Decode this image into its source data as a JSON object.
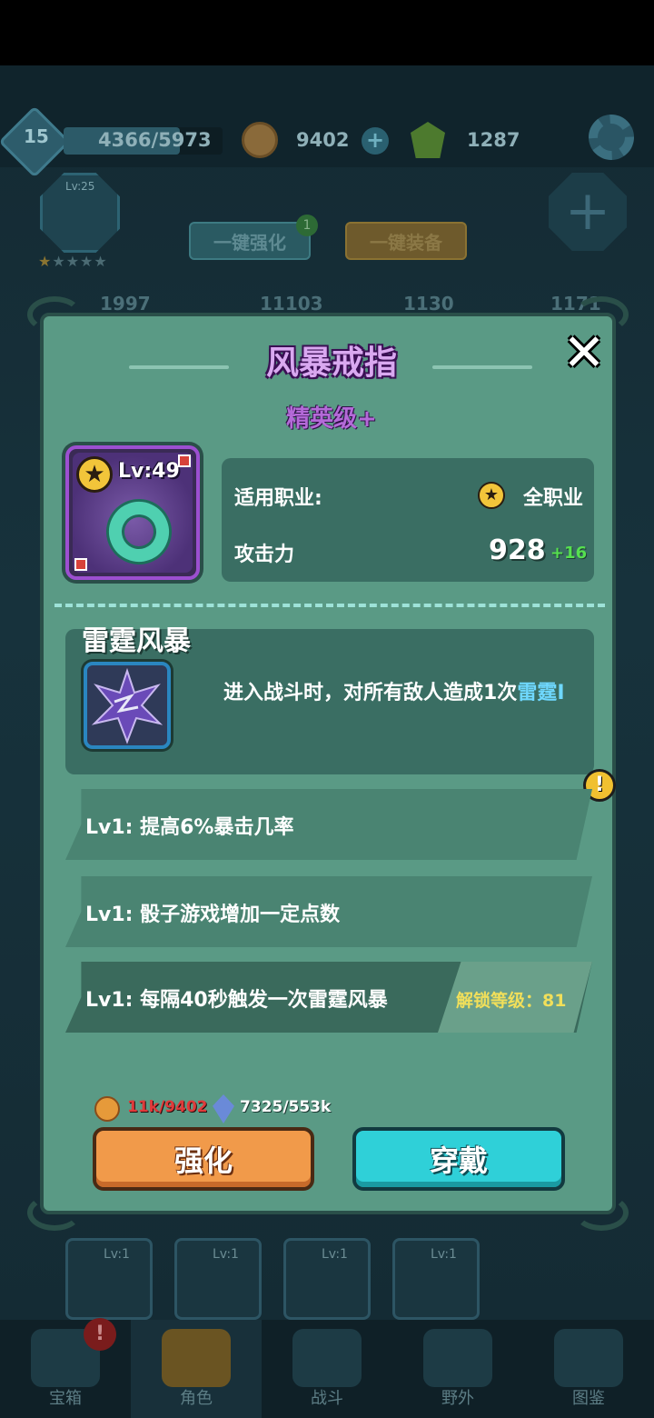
{
  "header": {
    "player_level": "15",
    "xp": "4366/5973",
    "xp_progress": 0.731,
    "coins": "9402",
    "gems": "1287"
  },
  "hero": {
    "level": "Lv:25",
    "stars": "★★★★★",
    "lit_stars": 1
  },
  "background_buttons": {
    "one_click_enhance": "一键强化",
    "enhance_badge": "1",
    "one_click_equip": "一键装备"
  },
  "background_stats": [
    "1997",
    "11103",
    "1130",
    "1171"
  ],
  "equipment_slots": [
    "Lv:1",
    "Lv:1",
    "Lv:1",
    "Lv:1"
  ],
  "tabs": [
    {
      "label": "宝箱",
      "icon": "chest-icon"
    },
    {
      "label": "角色",
      "icon": "helmet-icon"
    },
    {
      "label": "战斗",
      "icon": "crossed-swords-icon"
    },
    {
      "label": "野外",
      "icon": "castle-icon"
    },
    {
      "label": "图鉴",
      "icon": "book-icon"
    }
  ],
  "modal": {
    "title": "风暴戒指",
    "close": "✕",
    "rarity": "精英级+",
    "item": {
      "level": "Lv:49",
      "icon": "jade-ring-icon"
    },
    "stats": {
      "class_label": "适用职业:",
      "class_value": "全职业",
      "attack_label": "攻击力",
      "attack_value": "928",
      "attack_bonus": "+16"
    },
    "skill": {
      "name": "雷霆风暴",
      "icon": "thunder-star-icon",
      "desc_main": "进入战斗时，对所有敌人造成1次",
      "desc_highlight": "雷霆I"
    },
    "warning": "!",
    "passives": [
      {
        "text": "Lv1:  提高6%暴击几率"
      },
      {
        "text": "Lv1:  骰子游戏增加一定点数"
      },
      {
        "text": "Lv1:  每隔40秒触发一次雷霆风暴",
        "unlock": "解锁等级：81"
      }
    ],
    "cost": {
      "coins": "11k/9402",
      "crystals": "7325/553k"
    },
    "buttons": {
      "upgrade": "强化",
      "wear": "穿戴"
    }
  },
  "colors": {
    "modal_bg": "#5a9a85",
    "title": "#d9a8f0",
    "rarity": "#b46ad8",
    "upgrade_button": "#f19a4a",
    "wear_button": "#2fd0d8",
    "bonus_green": "#56e04f",
    "cost_insufficient": "#e03a3a",
    "unlock_text": "#f1df5a"
  }
}
